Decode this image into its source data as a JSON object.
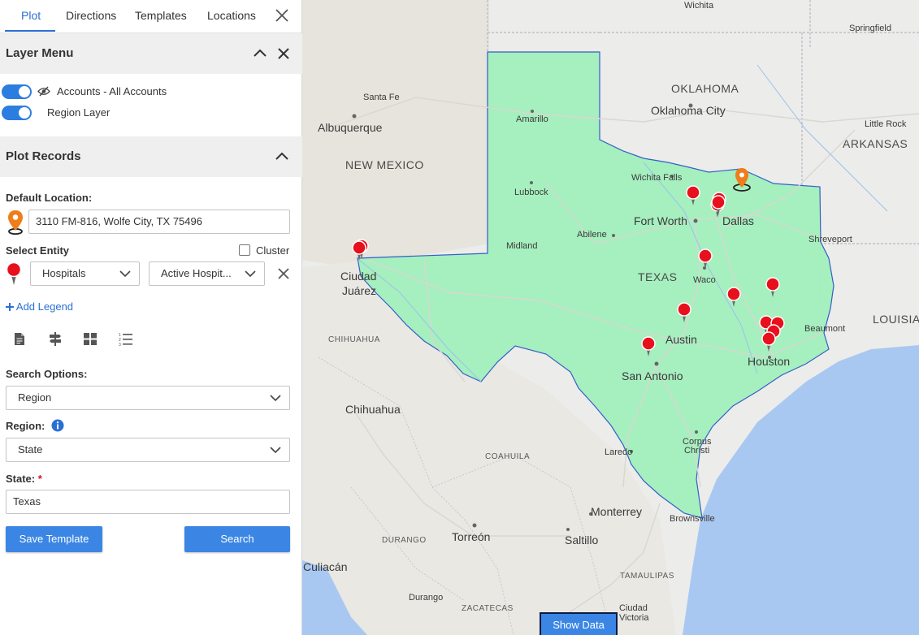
{
  "tabs": [
    "Plot",
    "Directions",
    "Templates",
    "Locations"
  ],
  "layer_menu": {
    "title": "Layer Menu",
    "layers": [
      "Accounts - All Accounts",
      "Region Layer"
    ]
  },
  "plot_records": {
    "title": "Plot Records",
    "default_location_label": "Default Location:",
    "default_location_value": "3110 FM-816, Wolfe City, TX 75496",
    "select_entity_label": "Select Entity",
    "cluster_label": "Cluster",
    "entity_value": "Hospitals",
    "filter_value": "Active Hospit...",
    "add_legend": "Add Legend",
    "search_options_label": "Search Options:",
    "search_options_value": "Region",
    "region_label": "Region:",
    "region_value": "State",
    "state_label": "State:",
    "required_mark": "*",
    "state_value": "Texas",
    "save_template": "Save Template",
    "search": "Search"
  },
  "map": {
    "labels": {
      "wichita": "Wichita",
      "springfield": "Springfield",
      "oklahoma": "OKLAHOMA",
      "oklahoma_city": "Oklahoma City",
      "santa_fe": "Santa Fe",
      "albuquerque": "Albuquerque",
      "little_rock": "Little Rock",
      "arkansas": "ARKANSAS",
      "amarillo": "Amarillo",
      "new_mexico": "NEW MEXICO",
      "wichita_falls": "Wichita Falls",
      "lubbock": "Lubbock",
      "fort_worth": "Fort Worth",
      "dallas": "Dallas",
      "shreveport": "Shreveport",
      "midland": "Midland",
      "abilene": "Abilene",
      "ciudad": "Ciudad",
      "juarez": "Juárez",
      "texas": "TEXAS",
      "waco": "Waco",
      "louisiana": "LOUISIA",
      "chihuahua_region": "CHIHUAHUA",
      "austin": "Austin",
      "beaumont": "Beaumont",
      "houston": "Houston",
      "san_antonio": "San Antonio",
      "chihuahua": "Chihuahua",
      "corpus": "Corpus",
      "christi": "Christi",
      "coahuila": "COAHUILA",
      "laredo": "Laredo",
      "monterrey": "Monterrey",
      "brownsville": "Brownsville",
      "durango_region": "DURANGO",
      "torreon": "Torreón",
      "saltillo": "Saltillo",
      "culiacan": "Culiacán",
      "tamaulipas": "TAMAULIPAS",
      "durango": "Durango",
      "zacatecas": "ZACATECAS",
      "ciudad2": "Ciudad",
      "victoria": "Victoria"
    },
    "show_data": "Show Data"
  },
  "colors": {
    "accent": "#2b6fd3",
    "button": "#3b86e4",
    "texas_fill": "#9ef0b8",
    "texas_border": "#2a58c6",
    "marker_red": "#e8101c",
    "marker_orange": "#f07d1a",
    "water": "#a8c8f2"
  },
  "icons": [
    "close-icon",
    "chevron-up-icon",
    "eye-slash-icon",
    "location-pin-icon",
    "chevron-down-icon",
    "plus-icon",
    "document-icon",
    "signpost-icon",
    "grid-icon",
    "list-icon",
    "info-icon",
    "hospital-marker-icon"
  ]
}
